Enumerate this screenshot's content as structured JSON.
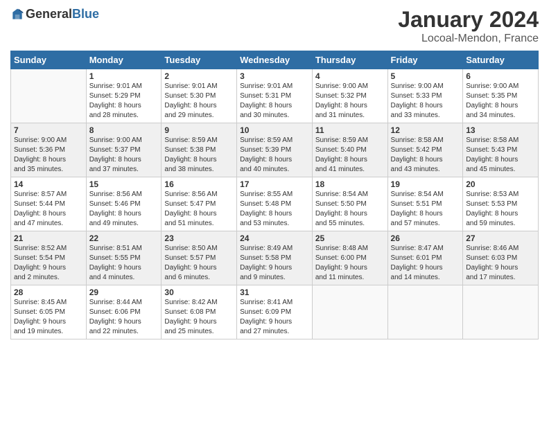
{
  "header": {
    "logo_general": "General",
    "logo_blue": "Blue",
    "month": "January 2024",
    "location": "Locoal-Mendon, France"
  },
  "days_of_week": [
    "Sunday",
    "Monday",
    "Tuesday",
    "Wednesday",
    "Thursday",
    "Friday",
    "Saturday"
  ],
  "weeks": [
    [
      {
        "day": "",
        "info": ""
      },
      {
        "day": "1",
        "info": "Sunrise: 9:01 AM\nSunset: 5:29 PM\nDaylight: 8 hours\nand 28 minutes."
      },
      {
        "day": "2",
        "info": "Sunrise: 9:01 AM\nSunset: 5:30 PM\nDaylight: 8 hours\nand 29 minutes."
      },
      {
        "day": "3",
        "info": "Sunrise: 9:01 AM\nSunset: 5:31 PM\nDaylight: 8 hours\nand 30 minutes."
      },
      {
        "day": "4",
        "info": "Sunrise: 9:00 AM\nSunset: 5:32 PM\nDaylight: 8 hours\nand 31 minutes."
      },
      {
        "day": "5",
        "info": "Sunrise: 9:00 AM\nSunset: 5:33 PM\nDaylight: 8 hours\nand 33 minutes."
      },
      {
        "day": "6",
        "info": "Sunrise: 9:00 AM\nSunset: 5:35 PM\nDaylight: 8 hours\nand 34 minutes."
      }
    ],
    [
      {
        "day": "7",
        "info": "Sunrise: 9:00 AM\nSunset: 5:36 PM\nDaylight: 8 hours\nand 35 minutes."
      },
      {
        "day": "8",
        "info": "Sunrise: 9:00 AM\nSunset: 5:37 PM\nDaylight: 8 hours\nand 37 minutes."
      },
      {
        "day": "9",
        "info": "Sunrise: 8:59 AM\nSunset: 5:38 PM\nDaylight: 8 hours\nand 38 minutes."
      },
      {
        "day": "10",
        "info": "Sunrise: 8:59 AM\nSunset: 5:39 PM\nDaylight: 8 hours\nand 40 minutes."
      },
      {
        "day": "11",
        "info": "Sunrise: 8:59 AM\nSunset: 5:40 PM\nDaylight: 8 hours\nand 41 minutes."
      },
      {
        "day": "12",
        "info": "Sunrise: 8:58 AM\nSunset: 5:42 PM\nDaylight: 8 hours\nand 43 minutes."
      },
      {
        "day": "13",
        "info": "Sunrise: 8:58 AM\nSunset: 5:43 PM\nDaylight: 8 hours\nand 45 minutes."
      }
    ],
    [
      {
        "day": "14",
        "info": "Sunrise: 8:57 AM\nSunset: 5:44 PM\nDaylight: 8 hours\nand 47 minutes."
      },
      {
        "day": "15",
        "info": "Sunrise: 8:56 AM\nSunset: 5:46 PM\nDaylight: 8 hours\nand 49 minutes."
      },
      {
        "day": "16",
        "info": "Sunrise: 8:56 AM\nSunset: 5:47 PM\nDaylight: 8 hours\nand 51 minutes."
      },
      {
        "day": "17",
        "info": "Sunrise: 8:55 AM\nSunset: 5:48 PM\nDaylight: 8 hours\nand 53 minutes."
      },
      {
        "day": "18",
        "info": "Sunrise: 8:54 AM\nSunset: 5:50 PM\nDaylight: 8 hours\nand 55 minutes."
      },
      {
        "day": "19",
        "info": "Sunrise: 8:54 AM\nSunset: 5:51 PM\nDaylight: 8 hours\nand 57 minutes."
      },
      {
        "day": "20",
        "info": "Sunrise: 8:53 AM\nSunset: 5:53 PM\nDaylight: 8 hours\nand 59 minutes."
      }
    ],
    [
      {
        "day": "21",
        "info": "Sunrise: 8:52 AM\nSunset: 5:54 PM\nDaylight: 9 hours\nand 2 minutes."
      },
      {
        "day": "22",
        "info": "Sunrise: 8:51 AM\nSunset: 5:55 PM\nDaylight: 9 hours\nand 4 minutes."
      },
      {
        "day": "23",
        "info": "Sunrise: 8:50 AM\nSunset: 5:57 PM\nDaylight: 9 hours\nand 6 minutes."
      },
      {
        "day": "24",
        "info": "Sunrise: 8:49 AM\nSunset: 5:58 PM\nDaylight: 9 hours\nand 9 minutes."
      },
      {
        "day": "25",
        "info": "Sunrise: 8:48 AM\nSunset: 6:00 PM\nDaylight: 9 hours\nand 11 minutes."
      },
      {
        "day": "26",
        "info": "Sunrise: 8:47 AM\nSunset: 6:01 PM\nDaylight: 9 hours\nand 14 minutes."
      },
      {
        "day": "27",
        "info": "Sunrise: 8:46 AM\nSunset: 6:03 PM\nDaylight: 9 hours\nand 17 minutes."
      }
    ],
    [
      {
        "day": "28",
        "info": "Sunrise: 8:45 AM\nSunset: 6:05 PM\nDaylight: 9 hours\nand 19 minutes."
      },
      {
        "day": "29",
        "info": "Sunrise: 8:44 AM\nSunset: 6:06 PM\nDaylight: 9 hours\nand 22 minutes."
      },
      {
        "day": "30",
        "info": "Sunrise: 8:42 AM\nSunset: 6:08 PM\nDaylight: 9 hours\nand 25 minutes."
      },
      {
        "day": "31",
        "info": "Sunrise: 8:41 AM\nSunset: 6:09 PM\nDaylight: 9 hours\nand 27 minutes."
      },
      {
        "day": "",
        "info": ""
      },
      {
        "day": "",
        "info": ""
      },
      {
        "day": "",
        "info": ""
      }
    ]
  ]
}
